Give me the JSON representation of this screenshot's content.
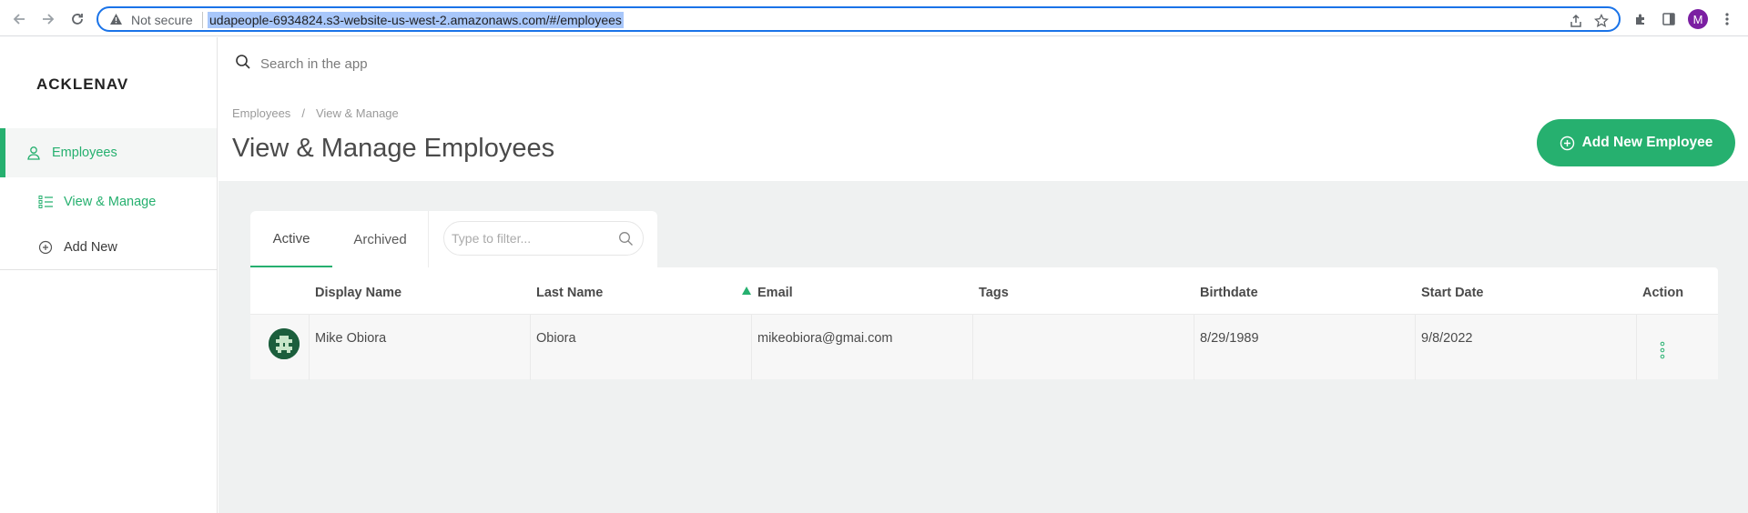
{
  "browser": {
    "not_secure": "Not secure",
    "url": "udapeople-6934824.s3-website-us-west-2.amazonaws.com/#/employees",
    "profile_initial": "M"
  },
  "sidebar": {
    "logo": "ACKLENAV",
    "items": [
      {
        "label": "Employees",
        "icon": "user-icon"
      },
      {
        "label": "View & Manage",
        "icon": "list-icon"
      },
      {
        "label": "Add New",
        "icon": "plus-circle-icon"
      }
    ]
  },
  "header": {
    "search_placeholder": "Search in the app",
    "breadcrumb": [
      "Employees",
      "/",
      "View & Manage"
    ],
    "title": "View & Manage Employees",
    "add_button": "Add New Employee"
  },
  "tabs": {
    "active": "Active",
    "archived": "Archived",
    "filter_placeholder": "Type to filter..."
  },
  "table": {
    "columns": [
      "Display Name",
      "Last Name",
      "Email",
      "Tags",
      "Birthdate",
      "Start Date",
      "Action"
    ],
    "rows": [
      {
        "display_name": "Mike Obiora",
        "last_name": "Obiora",
        "email": "mikeobiora@gmai.com",
        "tags": "",
        "birthdate": "8/29/1989",
        "start_date": "9/8/2022"
      }
    ]
  },
  "colors": {
    "accent": "#26b06f",
    "omnibox_focus": "#1a73e8",
    "profile": "#7b1fa2"
  }
}
